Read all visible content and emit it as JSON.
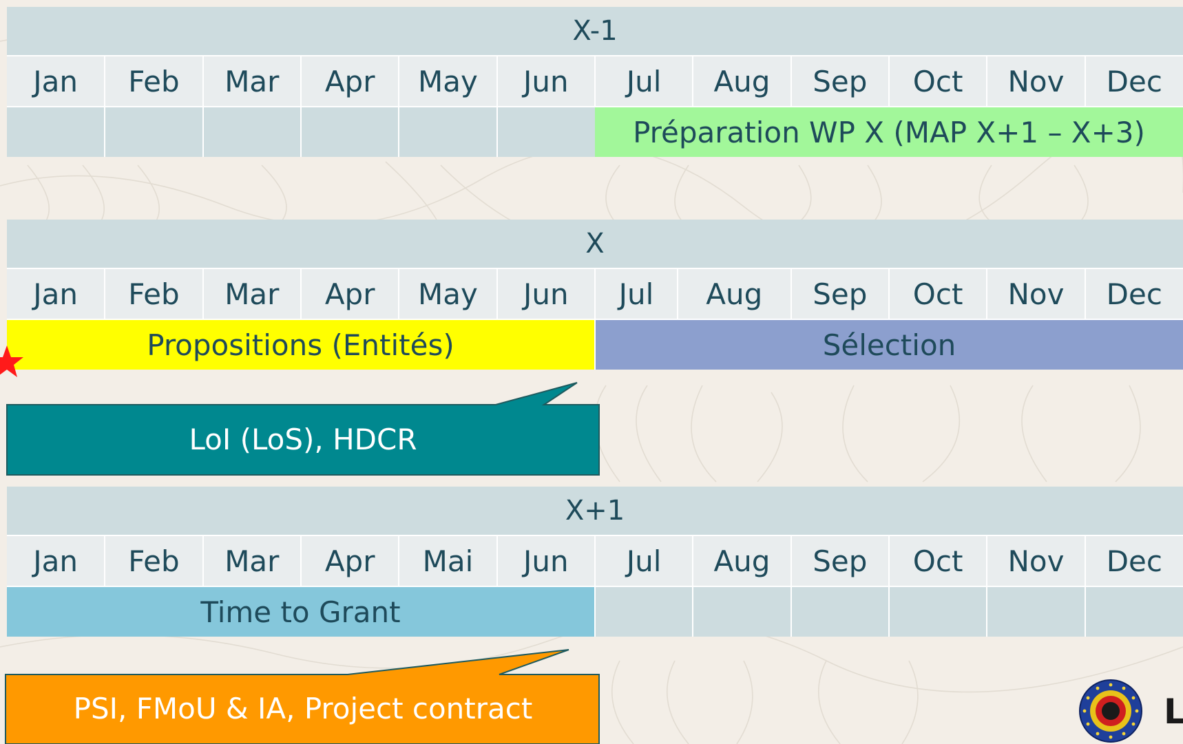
{
  "sections": [
    {
      "year": "X-1",
      "months": [
        "Jan",
        "Feb",
        "Mar",
        "Apr",
        "May",
        "Jun",
        "Jul",
        "Aug",
        "Sep",
        "Oct",
        "Nov",
        "Dec"
      ],
      "bands": [
        "Préparation WP X (MAP X+1 – X+3)"
      ]
    },
    {
      "year": "X",
      "months": [
        "Jan",
        "Feb",
        "Mar",
        "Apr",
        "May",
        "Jun",
        "Jul",
        "Aug",
        "Sep",
        "Oct",
        "Nov",
        "Dec"
      ],
      "bands": [
        "Propositions (Entités)",
        "Sélection"
      ],
      "callout": "LoI (LoS), HDCR"
    },
    {
      "year": "X+1",
      "months": [
        "Jan",
        "Feb",
        "Mar",
        "Apr",
        "Mai",
        "Jun",
        "Jul",
        "Aug",
        "Sep",
        "Oct",
        "Nov",
        "Dec"
      ],
      "bands": [
        "Time to Grant"
      ],
      "callout": "PSI, FMoU & IA, Project contract"
    }
  ],
  "colors": {
    "year_bar": "#cddcdf",
    "month_row": "#e9edee",
    "preparation": "#a2f79a",
    "propositions": "#ffff00",
    "selection": "#8c9fce",
    "time_to_grant": "#85c7db",
    "callout_teal": "#00888f",
    "callout_orange": "#ff9900",
    "text": "#1e4a5a"
  },
  "icons": [
    "red-star-icon",
    "belgian-defence-emblem-icon"
  ],
  "logo_text": "L"
}
